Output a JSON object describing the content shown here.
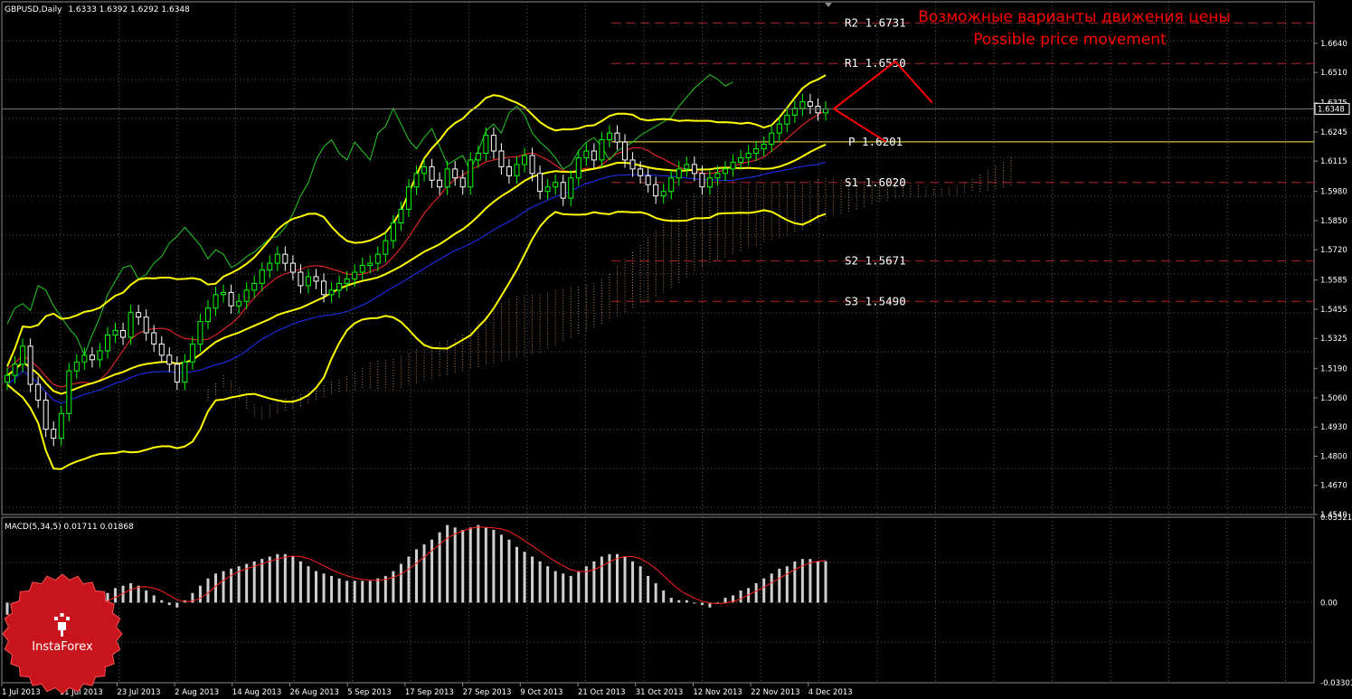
{
  "chart_data": [
    {
      "type": "candlestick",
      "title": "GBPUSD,Daily",
      "ohlc_header": "1.6333 1.6392 1.6292 1.6348",
      "current_price_label": "1.6348",
      "current_price": 1.6348,
      "ylim": [
        1.454,
        1.6825
      ],
      "y_ticks": [
        "1.6640",
        "1.6510",
        "1.6375",
        "1.6245",
        "1.6115",
        "1.5980",
        "1.5850",
        "1.5720",
        "1.5585",
        "1.5455",
        "1.5325",
        "1.5190",
        "1.5060",
        "1.4930",
        "1.4800",
        "1.4670",
        "1.4540"
      ],
      "x_ticks": [
        "1 Jul 2013",
        "11 Jul 2013",
        "23 Jul 2013",
        "2 Aug 2013",
        "14 Aug 2013",
        "26 Aug 2013",
        "5 Sep 2013",
        "17 Sep 2013",
        "27 Sep 2013",
        "9 Oct 2013",
        "21 Oct 2013",
        "31 Oct 2013",
        "12 Nov 2013",
        "22 Nov 2013",
        "4 Dec 2013"
      ],
      "levels": [
        {
          "name": "R2",
          "label": "R2 1.6731",
          "value": 1.6731
        },
        {
          "name": "R1",
          "label": "R1 1.6550",
          "value": 1.655
        },
        {
          "name": "P",
          "label": "P 1.6201",
          "value": 1.6201
        },
        {
          "name": "S1",
          "label": "S1 1.6020",
          "value": 1.602
        },
        {
          "name": "S2",
          "label": "S2 1.5671",
          "value": 1.5671
        },
        {
          "name": "S3",
          "label": "S3 1.5490",
          "value": 1.549
        }
      ],
      "annotations": [
        "Возможные варианты движения цены",
        "Possible price movement"
      ],
      "forecast_paths": [
        {
          "direction": "up",
          "points": [
            [
              0,
              1.6348
            ],
            [
              1.0,
              1.656
            ],
            [
              1.6,
              1.6375
            ]
          ]
        },
        {
          "direction": "down",
          "points": [
            [
              0,
              1.6348
            ],
            [
              0.85,
              1.6201
            ]
          ]
        }
      ],
      "closes": [
        1.516,
        1.521,
        1.529,
        1.512,
        1.505,
        1.492,
        1.488,
        1.499,
        1.518,
        1.522,
        1.525,
        1.523,
        1.527,
        1.534,
        1.536,
        1.533,
        1.544,
        1.542,
        1.535,
        1.53,
        1.525,
        1.521,
        1.513,
        1.522,
        1.53,
        1.54,
        1.546,
        1.552,
        1.553,
        1.547,
        1.549,
        1.554,
        1.557,
        1.563,
        1.566,
        1.57,
        1.566,
        1.562,
        1.556,
        1.56,
        1.558,
        1.552,
        1.554,
        1.557,
        1.559,
        1.562,
        1.565,
        1.566,
        1.57,
        1.576,
        1.584,
        1.59,
        1.6,
        1.606,
        1.609,
        1.603,
        1.6,
        1.608,
        1.604,
        1.6,
        1.612,
        1.615,
        1.623,
        1.616,
        1.609,
        1.605,
        1.61,
        1.614,
        1.606,
        1.598,
        1.6,
        1.602,
        1.595,
        1.604,
        1.613,
        1.616,
        1.612,
        1.621,
        1.624,
        1.62,
        1.612,
        1.608,
        1.605,
        1.601,
        1.596,
        1.598,
        1.604,
        1.608,
        1.61,
        1.606,
        1.6,
        1.604,
        1.606,
        1.608,
        1.611,
        1.613,
        1.615,
        1.617,
        1.619,
        1.624,
        1.628,
        1.632,
        1.635,
        1.638,
        1.636,
        1.633,
        1.6348
      ],
      "indicators": {
        "bollinger_upper_close": 1.647,
        "bollinger_lower_close": 1.592,
        "ichimoku_cloud": true,
        "moving_averages": [
          "yellow",
          "red",
          "blue",
          "green"
        ]
      },
      "colors": {
        "background": "#000000",
        "bull": "#00ff00",
        "bear": "#ffffff",
        "bands": "#ffff00",
        "annotation": "#ff0000",
        "levels": "#b22222"
      }
    },
    {
      "type": "bar",
      "title": "MACD(5,34,5) 0.01711 0.01868",
      "y_ticks": [
        "0.03521",
        "0.00",
        "-0.03301"
      ],
      "ylim": [
        -0.03301,
        0.03521
      ],
      "signal_line": true,
      "values": [
        -0.005,
        -0.006,
        -0.006,
        -0.005,
        -0.004,
        -0.003,
        -0.004,
        -0.005,
        -0.003,
        -0.002,
        -0.001,
        0.0,
        0.002,
        0.004,
        0.006,
        0.007,
        0.008,
        0.007,
        0.005,
        0.003,
        0.001,
        -0.001,
        -0.002,
        0.001,
        0.004,
        0.007,
        0.01,
        0.012,
        0.013,
        0.014,
        0.015,
        0.016,
        0.017,
        0.018,
        0.019,
        0.02,
        0.02,
        0.019,
        0.017,
        0.015,
        0.013,
        0.012,
        0.011,
        0.01,
        0.009,
        0.009,
        0.009,
        0.009,
        0.01,
        0.011,
        0.013,
        0.016,
        0.019,
        0.022,
        0.024,
        0.026,
        0.029,
        0.032,
        0.031,
        0.03,
        0.031,
        0.032,
        0.031,
        0.03,
        0.028,
        0.026,
        0.023,
        0.021,
        0.019,
        0.017,
        0.015,
        0.013,
        0.012,
        0.011,
        0.013,
        0.015,
        0.017,
        0.019,
        0.02,
        0.02,
        0.019,
        0.017,
        0.015,
        0.011,
        0.008,
        0.005,
        0.002,
        0.001,
        0.001,
        0.0,
        -0.001,
        -0.002,
        0.0,
        0.002,
        0.003,
        0.005,
        0.006,
        0.008,
        0.01,
        0.012,
        0.014,
        0.015,
        0.017,
        0.018,
        0.018,
        0.017,
        0.0171
      ]
    }
  ],
  "branding": {
    "logo_text": "InstaForex"
  }
}
